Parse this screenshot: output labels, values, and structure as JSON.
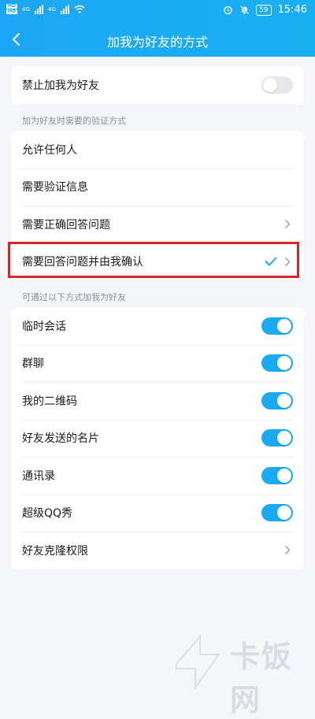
{
  "status": {
    "sim1": "HD",
    "sim2": "HD",
    "network1": "4G",
    "network2": "4G",
    "battery": "59",
    "time": "15:46"
  },
  "nav": {
    "title": "加我为好友的方式"
  },
  "block_section": {
    "label": "禁止加我为好友",
    "enabled": false
  },
  "verify_section": {
    "title": "加为好友时需要的验证方式",
    "options": [
      {
        "label": "允许任何人",
        "selected": false,
        "has_arrow": false
      },
      {
        "label": "需要验证信息",
        "selected": false,
        "has_arrow": false
      },
      {
        "label": "需要正确回答问题",
        "selected": false,
        "has_arrow": true
      },
      {
        "label": "需要回答问题并由我确认",
        "selected": true,
        "has_arrow": true
      }
    ]
  },
  "source_section": {
    "title": "可通过以下方式加我为好友",
    "items": [
      {
        "label": "临时会话",
        "enabled": true
      },
      {
        "label": "群聊",
        "enabled": true
      },
      {
        "label": "我的二维码",
        "enabled": true
      },
      {
        "label": "好友发送的名片",
        "enabled": true
      },
      {
        "label": "通讯录",
        "enabled": true
      },
      {
        "label": "超级QQ秀",
        "enabled": true
      },
      {
        "label": "好友克隆权限",
        "enabled": null
      }
    ]
  },
  "watermark": "卡饭网",
  "colors": {
    "accent": "#19aaf3",
    "highlight": "#d92626",
    "background": "#f4f6fa"
  }
}
